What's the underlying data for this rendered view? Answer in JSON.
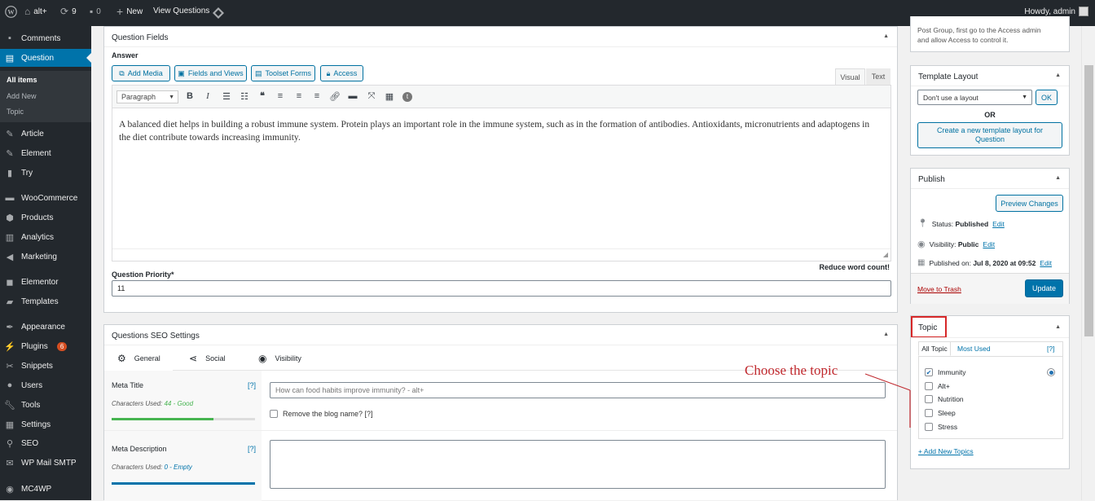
{
  "admin_bar": {
    "site_name": "alt+",
    "updates_count": "9",
    "comments_count": "0",
    "new_label": "New",
    "view_label": "View Questions",
    "greeting": "Howdy, admin"
  },
  "sidebar": {
    "items": [
      {
        "label": "Comments",
        "icon": "comments-icon"
      },
      {
        "label": "Question",
        "icon": "question-icon"
      },
      {
        "label": "Article",
        "icon": "article-icon"
      },
      {
        "label": "Element",
        "icon": "element-icon"
      },
      {
        "label": "Try",
        "icon": "try-icon"
      },
      {
        "label": "WooCommerce",
        "icon": "woocommerce-icon"
      },
      {
        "label": "Products",
        "icon": "products-icon"
      },
      {
        "label": "Analytics",
        "icon": "analytics-icon"
      },
      {
        "label": "Marketing",
        "icon": "marketing-icon"
      },
      {
        "label": "Elementor",
        "icon": "elementor-icon"
      },
      {
        "label": "Templates",
        "icon": "templates-icon"
      },
      {
        "label": "Appearance",
        "icon": "appearance-icon"
      },
      {
        "label": "Plugins",
        "icon": "plugins-icon",
        "badge": "6"
      },
      {
        "label": "Snippets",
        "icon": "snippets-icon"
      },
      {
        "label": "Users",
        "icon": "users-icon"
      },
      {
        "label": "Tools",
        "icon": "tools-icon"
      },
      {
        "label": "Settings",
        "icon": "settings-icon"
      },
      {
        "label": "SEO",
        "icon": "seo-icon"
      },
      {
        "label": "WP Mail SMTP",
        "icon": "mail-icon"
      },
      {
        "label": "MC4WP",
        "icon": "mc4wp-icon"
      }
    ],
    "submenu": [
      "All items",
      "Add New",
      "Topic"
    ]
  },
  "question_fields": {
    "title": "Question Fields",
    "answer_label": "Answer",
    "buttons": [
      "Add Media",
      "Fields and Views",
      "Toolset Forms",
      "Access"
    ],
    "tabs": [
      "Visual",
      "Text"
    ],
    "format_select": "Paragraph",
    "content": "A balanced diet helps in building a robust immune system. Protein plays an important role in the immune system, such as in the formation of antibodies. Antioxidants, micronutrients and adaptogens in the diet contribute towards increasing immunity.",
    "word_count_note": "Reduce word count!",
    "priority_label": "Question Priority*",
    "priority_value": "11"
  },
  "seo": {
    "title": "Questions SEO Settings",
    "tabs": [
      "General",
      "Social",
      "Visibility"
    ],
    "meta_title_label": "Meta Title",
    "help": "[?]",
    "meta_title_chars_prefix": "Characters Used: ",
    "meta_title_chars_value": "44 - Good",
    "meta_title_value": "How can food habits improve immunity? - alt+",
    "remove_blog_name": "Remove the blog name? [?]",
    "meta_desc_label": "Meta Description",
    "meta_desc_chars_prefix": "Characters Used: ",
    "meta_desc_chars_value": "0 - Empty"
  },
  "access_note": {
    "line1": "Post Group, first go to the Access admin",
    "line2": "and allow Access to control it."
  },
  "template_layout": {
    "title": "Template Layout",
    "select": "Don't use a layout",
    "ok": "OK",
    "or": "OR",
    "create": "Create a new template layout for Question"
  },
  "publish": {
    "title": "Publish",
    "preview": "Preview Changes",
    "status_label": "Status: ",
    "status_value": "Published",
    "visibility_label": "Visibility: ",
    "visibility_value": "Public",
    "published_label": "Published on: ",
    "published_value": "Jul 8, 2020 at 09:52",
    "edit": "Edit",
    "trash": "Move to Trash",
    "update": "Update"
  },
  "topic": {
    "title": "Topic",
    "tabs": [
      "All Topic",
      "Most Used"
    ],
    "help": "[?]",
    "items": [
      {
        "label": "Immunity",
        "checked": true
      },
      {
        "label": "Alt+",
        "checked": false
      },
      {
        "label": "Nutrition",
        "checked": false
      },
      {
        "label": "Sleep",
        "checked": false
      },
      {
        "label": "Stress",
        "checked": false
      }
    ],
    "add_new": "+ Add New Topics"
  },
  "annotation": {
    "text": "Choose the topic",
    "color": "#c0282d"
  }
}
